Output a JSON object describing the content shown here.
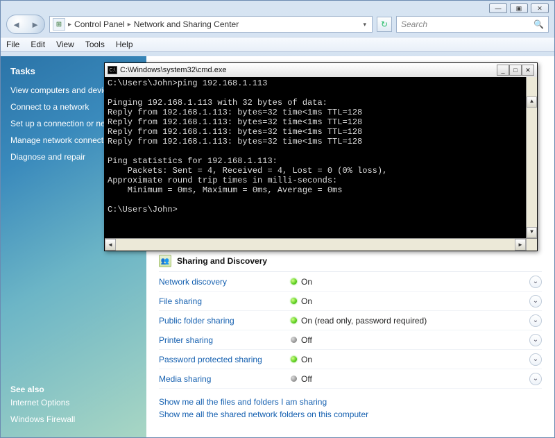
{
  "window_controls": {
    "min": "—",
    "max": "▣",
    "close": "✕"
  },
  "breadcrumbs": {
    "item1": "Control Panel",
    "item2": "Network and Sharing Center"
  },
  "search": {
    "placeholder": "Search"
  },
  "menu": {
    "file": "File",
    "edit": "Edit",
    "view": "View",
    "tools": "Tools",
    "help": "Help"
  },
  "sidebar": {
    "heading": "Tasks",
    "items": [
      "View computers and devices",
      "Connect to a network",
      "Set up a connection or network",
      "Manage network connections",
      "Diagnose and repair"
    ],
    "see_also": "See also",
    "see_items": [
      "Internet Options",
      "Windows Firewall"
    ]
  },
  "sharing": {
    "heading": "Sharing and Discovery",
    "rows": [
      {
        "label": "Network discovery",
        "status": "on",
        "text": "On"
      },
      {
        "label": "File sharing",
        "status": "on",
        "text": "On"
      },
      {
        "label": "Public folder sharing",
        "status": "on",
        "text": "On (read only, password required)"
      },
      {
        "label": "Printer sharing",
        "status": "off",
        "text": "Off"
      },
      {
        "label": "Password protected sharing",
        "status": "on",
        "text": "On"
      },
      {
        "label": "Media sharing",
        "status": "off",
        "text": "Off"
      }
    ],
    "link1": "Show me all the files and folders I am sharing",
    "link2": "Show me all the shared network folders on this computer"
  },
  "cmd": {
    "title": "C:\\Windows\\system32\\cmd.exe",
    "lines": [
      "C:\\Users\\John>ping 192.168.1.113",
      "",
      "Pinging 192.168.1.113 with 32 bytes of data:",
      "Reply from 192.168.1.113: bytes=32 time<1ms TTL=128",
      "Reply from 192.168.1.113: bytes=32 time<1ms TTL=128",
      "Reply from 192.168.1.113: bytes=32 time<1ms TTL=128",
      "Reply from 192.168.1.113: bytes=32 time<1ms TTL=128",
      "",
      "Ping statistics for 192.168.1.113:",
      "    Packets: Sent = 4, Received = 4, Lost = 0 (0% loss),",
      "Approximate round trip times in milli-seconds:",
      "    Minimum = 0ms, Maximum = 0ms, Average = 0ms",
      "",
      "C:\\Users\\John>"
    ]
  }
}
